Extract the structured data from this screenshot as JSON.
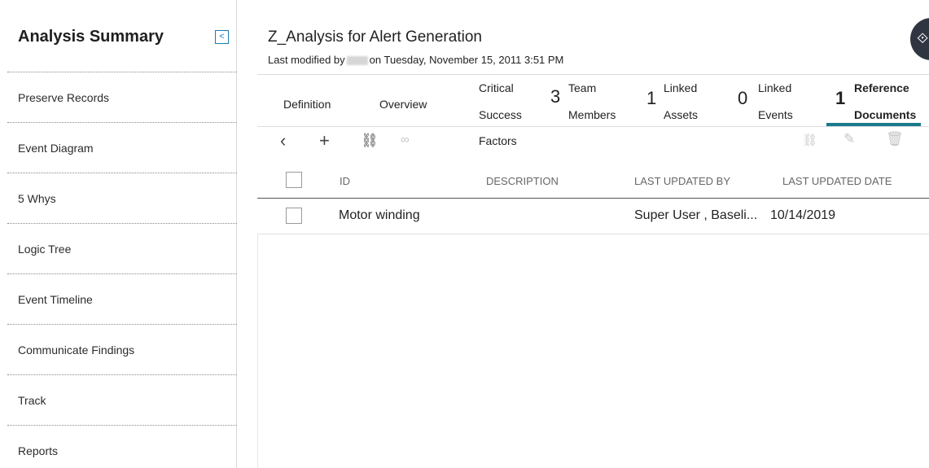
{
  "sidebar": {
    "title": "Analysis Summary",
    "collapse_icon": "<",
    "items": [
      {
        "label": "Preserve Records"
      },
      {
        "label": "Event Diagram"
      },
      {
        "label": "5 Whys"
      },
      {
        "label": "Logic Tree"
      },
      {
        "label": "Event Timeline"
      },
      {
        "label": "Communicate Findings"
      },
      {
        "label": "Track"
      },
      {
        "label": "Reports"
      }
    ]
  },
  "header": {
    "title": "Z_Analysis for Alert Generation",
    "modified_prefix": "Last modified by",
    "modified_suffix": "on Tuesday, November 15, 2011 3:51 PM"
  },
  "tabs": {
    "definition": "Definition",
    "overview": "Overview",
    "critical_l1": "Critical",
    "critical_l2": "Success",
    "critical_l3": "Factors",
    "team_count": "3",
    "team_l1": "Team",
    "team_l2": "Members",
    "assets_count": "1",
    "assets_l1": "Linked",
    "assets_l2": "Assets",
    "events_count": "0",
    "events_l1": "Linked",
    "events_l2": "Events",
    "refdocs_count": "1",
    "refdocs_l1": "Reference",
    "refdocs_l2": "Documents"
  },
  "toolbar": {
    "back_icon": "back-chevron-icon",
    "add_icon": "plus-icon",
    "link_icon": "link-icon",
    "search_icon": "binoculars-icon",
    "unlink_icon": "unlink-icon",
    "edit_icon": "pencil-icon",
    "delete_icon": "trash-icon"
  },
  "table": {
    "columns": [
      "ID",
      "DESCRIPTION",
      "LAST UPDATED BY",
      "LAST UPDATED DATE"
    ],
    "rows": [
      {
        "id": "Motor winding",
        "description": "",
        "updated_by": "Super User , Baseli...",
        "updated_date": "10/14/2019"
      }
    ]
  },
  "colors": {
    "accent": "#1b7a8c",
    "collapse": "#1a7bb9",
    "corner_button": "#2f3642"
  }
}
